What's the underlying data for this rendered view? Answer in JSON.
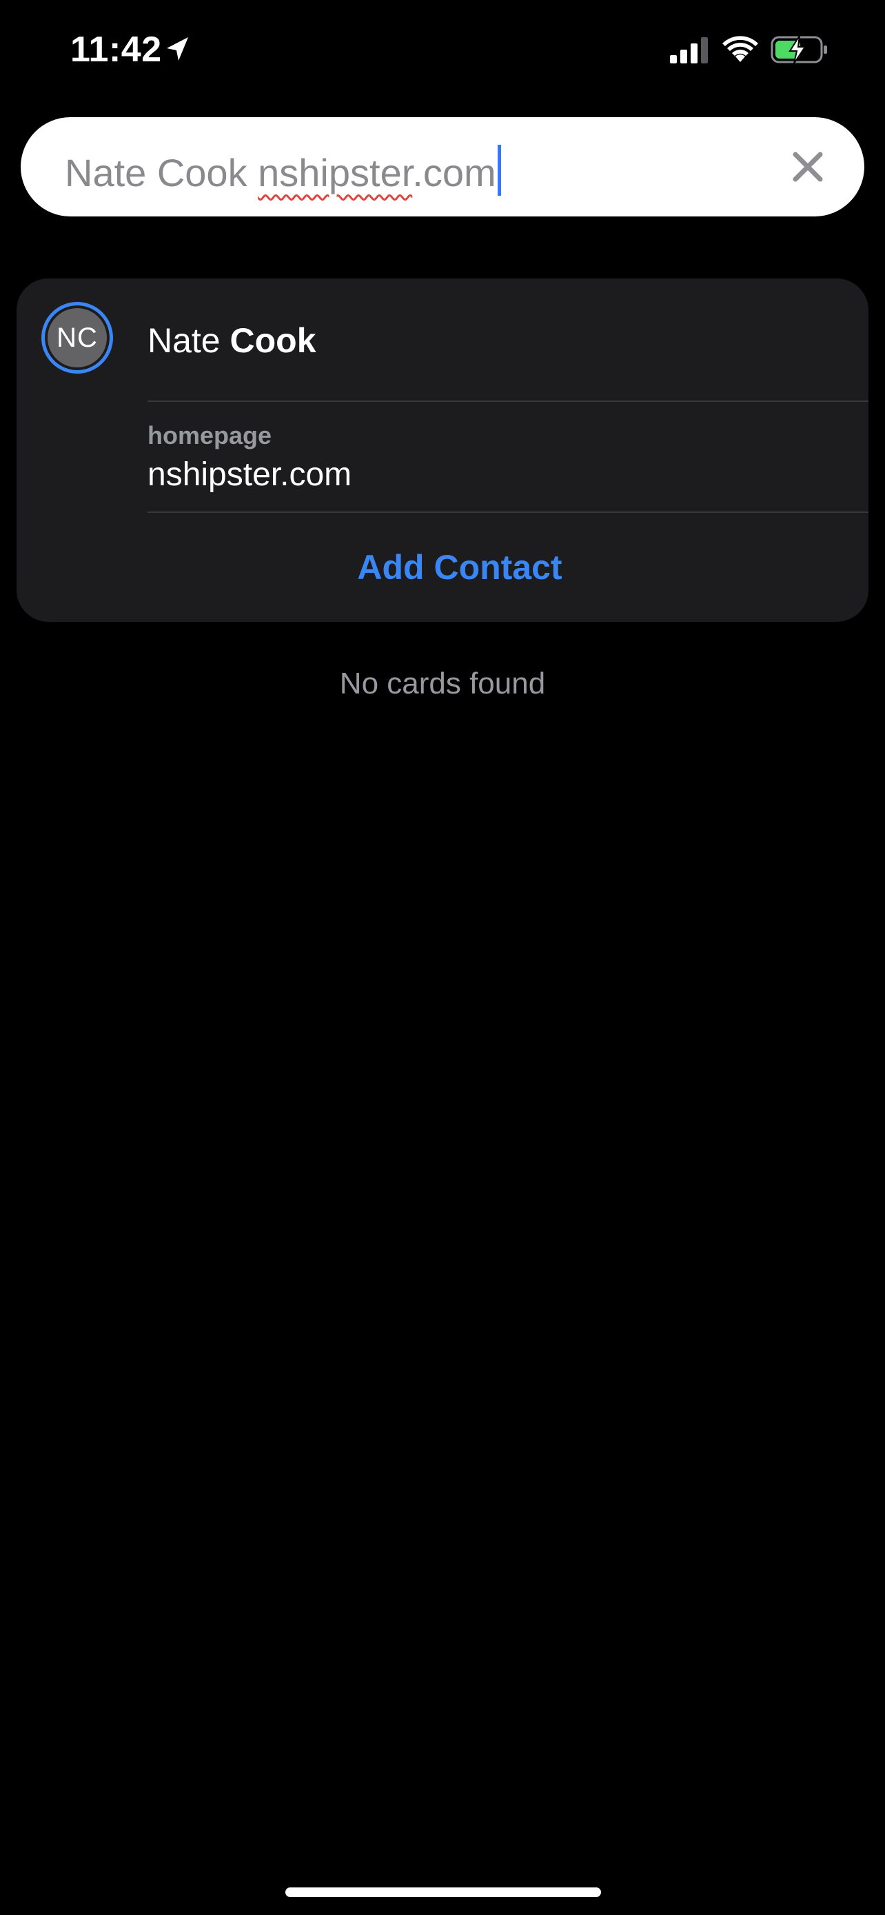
{
  "status_bar": {
    "time": "11:42",
    "icons": [
      "location-arrow-icon",
      "cellular-signal-icon",
      "wifi-icon",
      "battery-charging-icon"
    ]
  },
  "search": {
    "query_prefix": "Nate Cook ",
    "query_misspelled": "nshipster",
    "query_suffix": ".com",
    "clear_icon": "clear-x-icon"
  },
  "contact": {
    "initials": "NC",
    "first_name": "Nate",
    "last_name": "Cook",
    "field_label": "homepage",
    "field_value": "nshipster.com",
    "add_button_label": "Add Contact"
  },
  "results": {
    "empty_message": "No cards found"
  },
  "colors": {
    "accent": "#3a86f5",
    "background": "#000000",
    "card": "#1c1c1e",
    "battery_green": "#4cd964"
  }
}
